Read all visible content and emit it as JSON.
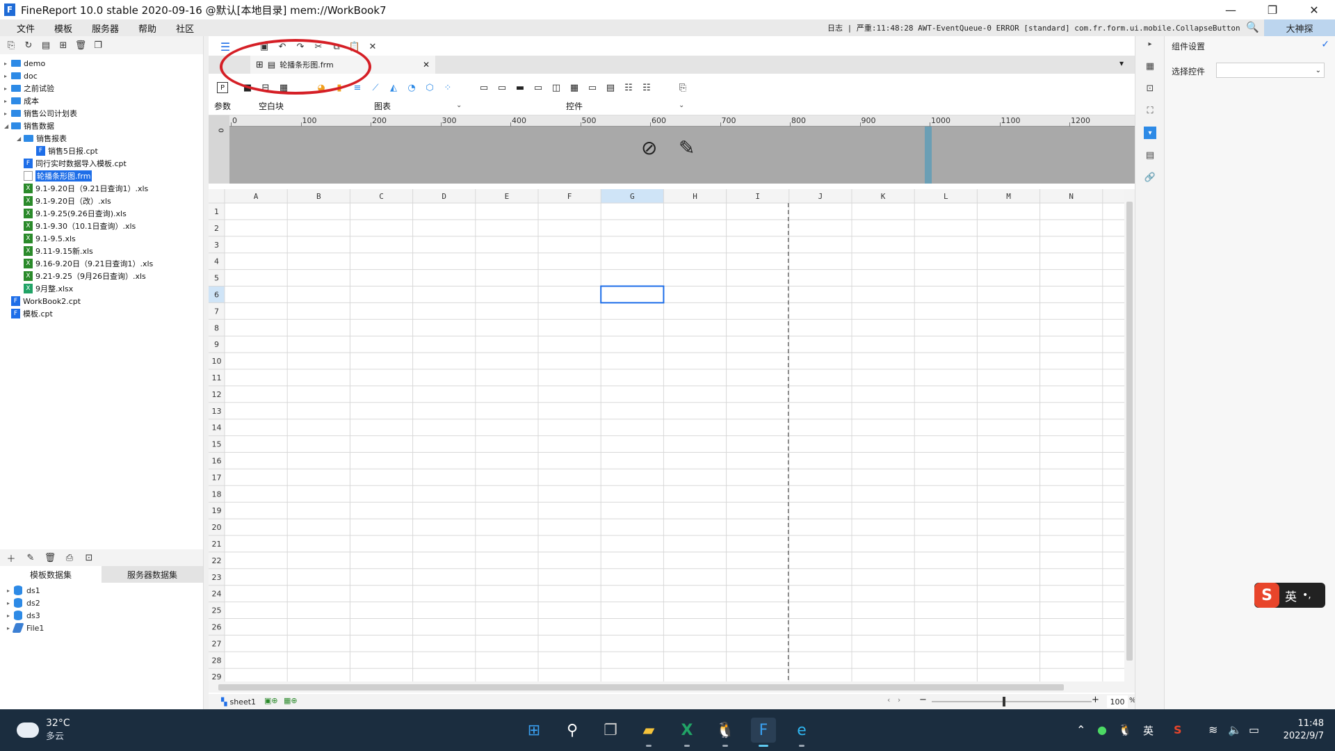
{
  "window": {
    "title": "FineReport 10.0 stable 2020-09-16 @默认[本地目录]    mem://WorkBook7",
    "min": "—",
    "restore": "❐",
    "close": "✕"
  },
  "menu": {
    "items": [
      "文件",
      "模板",
      "服务器",
      "帮助",
      "社区"
    ],
    "log": "日志 | 严重:11:48:28 AWT-EventQueue-0 ERROR [standard] com.fr.form.ui.mobile.CollapseButton",
    "user": "大神探"
  },
  "tree": {
    "items": [
      {
        "label": "demo",
        "type": "folder",
        "level": 0,
        "expanded": false
      },
      {
        "label": "doc",
        "type": "folder",
        "level": 0,
        "expanded": false
      },
      {
        "label": "之前试验",
        "type": "folder",
        "level": 0,
        "expanded": false
      },
      {
        "label": "成本",
        "type": "folder",
        "level": 0,
        "expanded": false
      },
      {
        "label": "销售公司计划表",
        "type": "folder",
        "level": 0,
        "expanded": false
      },
      {
        "label": "销售数据",
        "type": "folder",
        "level": 0,
        "expanded": true
      },
      {
        "label": "销售报表",
        "type": "folder",
        "level": 1,
        "expanded": true
      },
      {
        "label": "销售5日报.cpt",
        "type": "cpt",
        "level": 2
      },
      {
        "label": "同行实时数据导入模板.cpt",
        "type": "cpt",
        "level": 1
      },
      {
        "label": "轮播条形图.frm",
        "type": "frm",
        "level": 1,
        "selected": true
      },
      {
        "label": "9.1-9.20日（9.21日查询1）.xls",
        "type": "xls",
        "level": 1
      },
      {
        "label": "9.1-9.20日（改）.xls",
        "type": "xls",
        "level": 1
      },
      {
        "label": "9.1-9.25(9.26日查询).xls",
        "type": "xls",
        "level": 1
      },
      {
        "label": "9.1-9.30（10.1日查询）.xls",
        "type": "xls",
        "level": 1
      },
      {
        "label": "9.1-9.5.xls",
        "type": "xls",
        "level": 1
      },
      {
        "label": "9.11-9.15新.xls",
        "type": "xls",
        "level": 1
      },
      {
        "label": "9.16-9.20日（9.21日查询1）.xls",
        "type": "xls",
        "level": 1
      },
      {
        "label": "9.21-9.25（9月26日查询）.xls",
        "type": "xls",
        "level": 1
      },
      {
        "label": "9月整.xlsx",
        "type": "xlsx",
        "level": 1
      },
      {
        "label": "WorkBook2.cpt",
        "type": "cpt",
        "level": 0
      },
      {
        "label": "模板.cpt",
        "type": "cpt",
        "level": 0
      }
    ]
  },
  "datasets": {
    "tabs": [
      "模板数据集",
      "服务器数据集"
    ],
    "items": [
      "ds1",
      "ds2",
      "ds3",
      "File1"
    ]
  },
  "editor": {
    "file_tab": "轮播条形图.frm",
    "widget_groups": {
      "param": "参数",
      "blank": "空白块",
      "chart": "图表",
      "control": "控件"
    },
    "ruler_ticks": [
      "0",
      "100",
      "200",
      "300",
      "400",
      "500",
      "600",
      "700",
      "800",
      "900",
      "1000",
      "1100",
      "1200"
    ],
    "columns": [
      "A",
      "B",
      "C",
      "D",
      "E",
      "F",
      "G",
      "H",
      "I",
      "J",
      "K",
      "L",
      "M",
      "N"
    ],
    "rows": 29,
    "selected_cell": "G6",
    "sheet": "sheet1",
    "zoom": "100",
    "zoom_pct": "%"
  },
  "right_panel": {
    "title": "组件设置",
    "select_label": "选择控件"
  },
  "ime": {
    "mode": "英",
    "punct": "•,"
  },
  "taskbar": {
    "temp": "32°C",
    "weather": "多云",
    "time": "11:48",
    "date": "2022/9/7",
    "lang": "英"
  }
}
